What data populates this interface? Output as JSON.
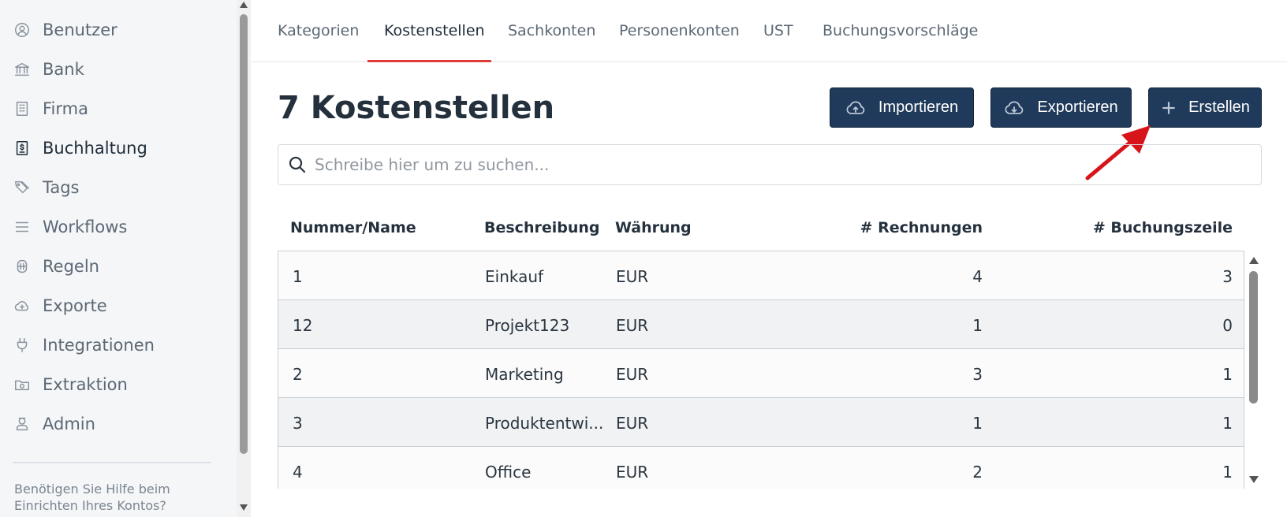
{
  "sidebar": {
    "items": [
      {
        "label": "Benutzer",
        "icon": "user-circle-icon"
      },
      {
        "label": "Bank",
        "icon": "bank-icon"
      },
      {
        "label": "Firma",
        "icon": "building-icon"
      },
      {
        "label": "Buchhaltung",
        "icon": "document-dollar-icon",
        "active": true
      },
      {
        "label": "Tags",
        "icon": "tags-icon"
      },
      {
        "label": "Workflows",
        "icon": "list-icon"
      },
      {
        "label": "Regeln",
        "icon": "rules-icon"
      },
      {
        "label": "Exporte",
        "icon": "cloud-export-icon"
      },
      {
        "label": "Integrationen",
        "icon": "plug-icon"
      },
      {
        "label": "Extraktion",
        "icon": "folder-extract-icon"
      },
      {
        "label": "Admin",
        "icon": "admin-icon"
      }
    ],
    "help_text": "Benötigen Sie Hilfe beim Einrichten Ihres Kontos?"
  },
  "tabs": [
    {
      "label": "Kategorien"
    },
    {
      "label": "Kostenstellen",
      "active": true
    },
    {
      "label": "Sachkonten"
    },
    {
      "label": "Personenkonten"
    },
    {
      "label": "UST"
    },
    {
      "label": "Buchungsvorschläge"
    }
  ],
  "main": {
    "title": "7 Kostenstellen",
    "buttons": {
      "import": "Importieren",
      "export": "Exportieren",
      "create": "Erstellen"
    },
    "search": {
      "placeholder": "Schreibe hier um zu suchen..."
    }
  },
  "table": {
    "headers": {
      "name": "Nummer/Name",
      "description": "Beschreibung",
      "currency": "Währung",
      "invoices": "# Rechnungen",
      "booking_lines": "# Buchungszeile"
    },
    "rows": [
      {
        "name": "1",
        "description": "Einkauf",
        "currency": "EUR",
        "invoices": "4",
        "booking_lines": "3"
      },
      {
        "name": "12",
        "description": "Projekt123",
        "currency": "EUR",
        "invoices": "1",
        "booking_lines": "0"
      },
      {
        "name": "2",
        "description": "Marketing",
        "currency": "EUR",
        "invoices": "3",
        "booking_lines": "1"
      },
      {
        "name": "3",
        "description": "Produktentwi...",
        "currency": "EUR",
        "invoices": "1",
        "booking_lines": "1"
      },
      {
        "name": "4",
        "description": "Office",
        "currency": "EUR",
        "invoices": "2",
        "booking_lines": "1"
      }
    ]
  },
  "colors": {
    "primary_button": "#1f3a5a",
    "active_tab_underline": "#e03a3a",
    "callout_arrow": "#d8141b",
    "sidebar_bg": "#f4f6f8"
  }
}
